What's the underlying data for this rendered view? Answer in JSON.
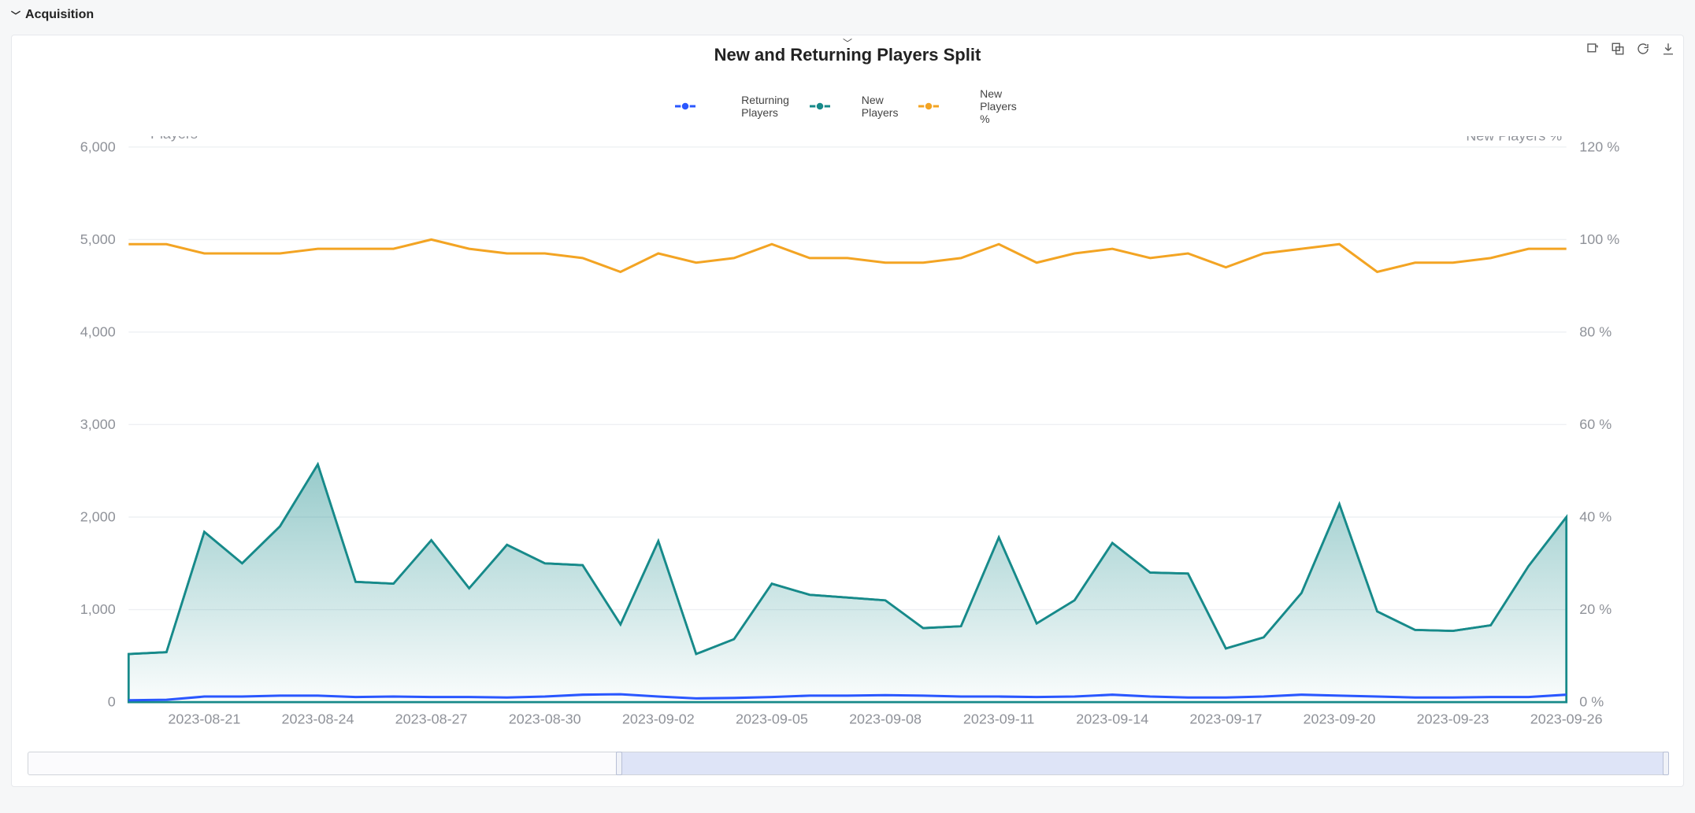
{
  "section": {
    "title": "Acquisition"
  },
  "panel": {
    "title": "New and Returning Players Split",
    "toolbar": {
      "tool1_name": "select-view-icon",
      "tool2_name": "copy-view-icon",
      "tool3_name": "refresh-icon",
      "tool4_name": "download-icon"
    }
  },
  "legend": {
    "items": [
      {
        "label": "Returning Players",
        "color": "#2a57ff",
        "marker": "circle"
      },
      {
        "label": "New Players",
        "color": "#178a8a",
        "marker": "circle"
      },
      {
        "label": "New Players %",
        "color": "#f3a423",
        "marker": "circle"
      }
    ]
  },
  "axes": {
    "left": {
      "label": "Players",
      "ticks": [
        0,
        1000,
        2000,
        3000,
        4000,
        5000,
        6000
      ],
      "tickLabels": [
        "0",
        "1,000",
        "2,000",
        "3,000",
        "4,000",
        "5,000",
        "6,000"
      ]
    },
    "right": {
      "label": "New Players %",
      "ticks": [
        0,
        20,
        40,
        60,
        80,
        100,
        120
      ],
      "tickLabels": [
        "0 %",
        "20 %",
        "40 %",
        "60 %",
        "80 %",
        "100 %",
        "120 %"
      ]
    },
    "x": {
      "tickEvery": 3,
      "tickLabels": [
        "2023-08-21",
        "2023-08-24",
        "2023-08-27",
        "2023-08-30",
        "2023-09-02",
        "2023-09-05",
        "2023-09-08",
        "2023-09-11",
        "2023-09-14",
        "2023-09-17",
        "2023-09-20",
        "2023-09-23",
        "2023-09-26"
      ]
    }
  },
  "chart_data": {
    "type": "line",
    "title": "New and Returning Players Split",
    "xlabel": "",
    "ylabel_left": "Players",
    "ylabel_right": "New Players %",
    "ylim_left": [
      0,
      6000
    ],
    "ylim_right": [
      0,
      120
    ],
    "x_dates": [
      "2023-08-19",
      "2023-08-20",
      "2023-08-21",
      "2023-08-22",
      "2023-08-23",
      "2023-08-24",
      "2023-08-25",
      "2023-08-26",
      "2023-08-27",
      "2023-08-28",
      "2023-08-29",
      "2023-08-30",
      "2023-08-31",
      "2023-09-01",
      "2023-09-02",
      "2023-09-03",
      "2023-09-04",
      "2023-09-05",
      "2023-09-06",
      "2023-09-07",
      "2023-09-08",
      "2023-09-09",
      "2023-09-10",
      "2023-09-11",
      "2023-09-12",
      "2023-09-13",
      "2023-09-14",
      "2023-09-15",
      "2023-09-16",
      "2023-09-17",
      "2023-09-18",
      "2023-09-19",
      "2023-09-20",
      "2023-09-21",
      "2023-09-22",
      "2023-09-23",
      "2023-09-24",
      "2023-09-25",
      "2023-09-26"
    ],
    "series": [
      {
        "name": "Returning Players",
        "axis": "left",
        "color": "#2a57ff",
        "style": "line",
        "values": [
          20,
          25,
          60,
          60,
          70,
          70,
          55,
          60,
          55,
          55,
          50,
          60,
          80,
          85,
          60,
          40,
          45,
          55,
          70,
          70,
          75,
          70,
          60,
          60,
          55,
          60,
          80,
          60,
          50,
          50,
          60,
          80,
          70,
          60,
          50,
          50,
          55,
          55,
          80
        ]
      },
      {
        "name": "New Players",
        "axis": "left",
        "color": "#178a8a",
        "style": "area",
        "values": [
          520,
          540,
          1840,
          1500,
          1900,
          2570,
          1300,
          1280,
          1750,
          1230,
          1700,
          1500,
          1480,
          840,
          1740,
          520,
          680,
          1280,
          1160,
          1130,
          1100,
          800,
          820,
          1780,
          850,
          1100,
          1720,
          1400,
          1390,
          580,
          700,
          1180,
          2140,
          980,
          780,
          770,
          830,
          1470,
          2000
        ]
      },
      {
        "name": "New Players %",
        "axis": "right",
        "color": "#f3a423",
        "style": "line",
        "values": [
          99,
          99,
          97,
          97,
          97,
          98,
          98,
          98,
          100,
          98,
          97,
          97,
          96,
          93,
          97,
          95,
          96,
          99,
          96,
          96,
          95,
          95,
          96,
          99,
          95,
          97,
          98,
          96,
          97,
          94,
          97,
          98,
          99,
          93,
          95,
          95,
          96,
          98,
          98
        ]
      }
    ],
    "brush": {
      "start_fraction": 0.36,
      "end_fraction": 1.0
    }
  }
}
